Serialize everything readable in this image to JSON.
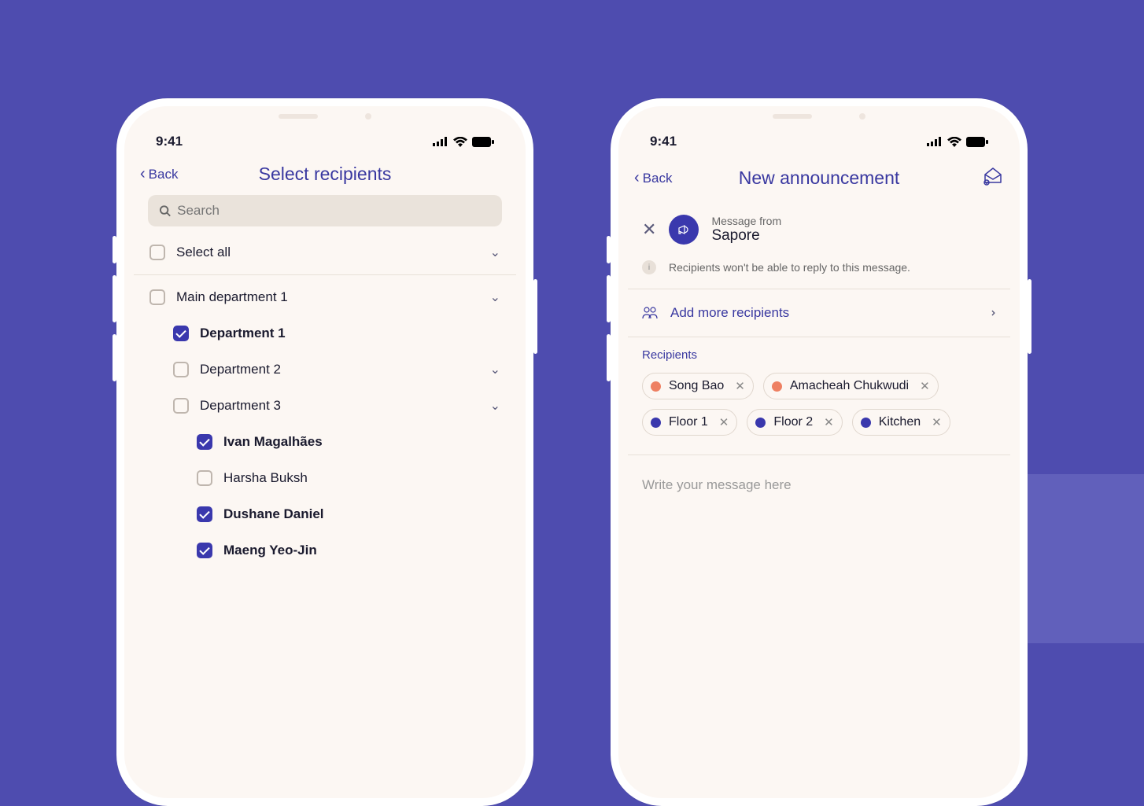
{
  "status": {
    "time": "9:41"
  },
  "phone1": {
    "back": "Back",
    "title": "Select recipients",
    "search_placeholder": "Search",
    "select_all": "Select all",
    "main_dept": "Main department 1",
    "dept1": "Department 1",
    "dept2": "Department 2",
    "dept3": "Department 3",
    "people": {
      "p1": "Ivan Magalhães",
      "p2": "Harsha Buksh",
      "p3": "Dushane Daniel",
      "p4": "Maeng Yeo-Jin"
    }
  },
  "phone2": {
    "back": "Back",
    "title": "New announcement",
    "from_label": "Message from",
    "from_name": "Sapore",
    "info_text": "Recipients won't be able to reply to this message.",
    "add_recipients": "Add more recipients",
    "recipients_label": "Recipients",
    "chips": {
      "c1": "Song Bao",
      "c2": "Amacheah Chukwudi",
      "c3": "Floor 1",
      "c4": "Floor 2",
      "c5": "Kitchen"
    },
    "compose_placeholder": "Write your message here"
  }
}
